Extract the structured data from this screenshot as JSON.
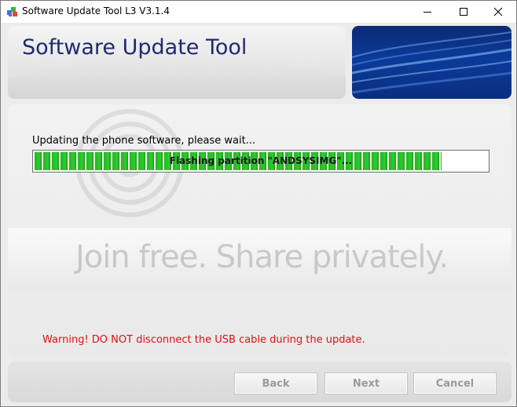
{
  "window": {
    "title": "Software Update Tool L3 V3.1.4",
    "icon": "app-icon"
  },
  "header": {
    "title": "Software Update Tool"
  },
  "main": {
    "status_label": "Updating the phone software, please wait...",
    "progress": {
      "text": "Flashing partition \"ANDSYSIMG\"...",
      "fraction": 0.9
    },
    "watermark_text": "Join free. Share privately.",
    "warning": "Warning! DO NOT disconnect the USB cable during the update."
  },
  "footer": {
    "back_label": "Back",
    "next_label": "Next",
    "cancel_label": "Cancel"
  },
  "colors": {
    "title_blue": "#1f2a6e",
    "warning_red": "#e01010",
    "progress_green": "#2ecc2e"
  }
}
